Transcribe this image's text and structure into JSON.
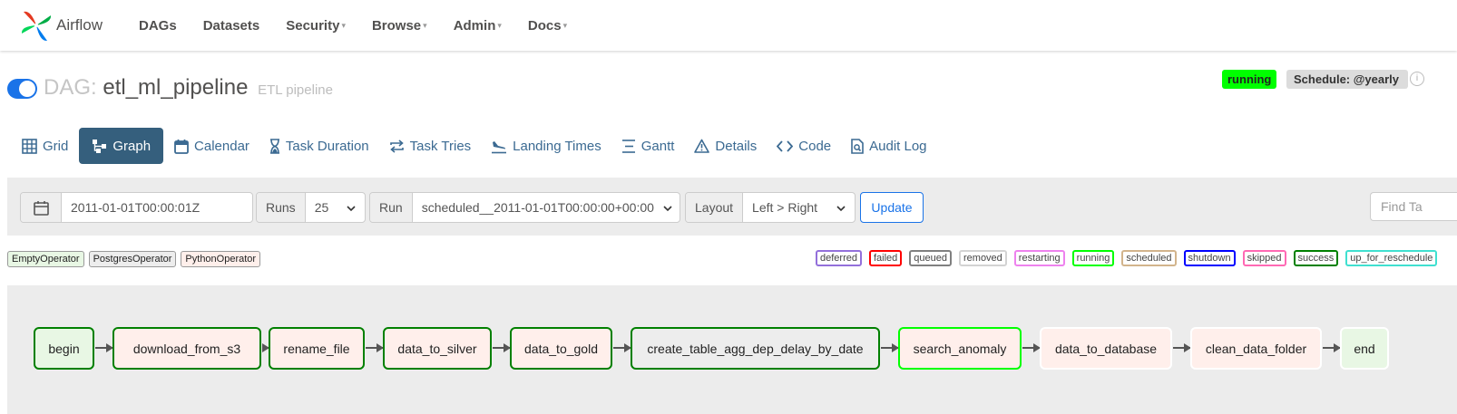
{
  "navbar": {
    "brand": "Airflow",
    "items": [
      {
        "label": "DAGs",
        "dropdown": false
      },
      {
        "label": "Datasets",
        "dropdown": false
      },
      {
        "label": "Security",
        "dropdown": true
      },
      {
        "label": "Browse",
        "dropdown": true
      },
      {
        "label": "Admin",
        "dropdown": true
      },
      {
        "label": "Docs",
        "dropdown": true
      }
    ]
  },
  "dag": {
    "prefix": "DAG:",
    "name": "etl_ml_pipeline",
    "description": "ETL pipeline",
    "status": "running",
    "schedule": "Schedule: @yearly",
    "paused": false
  },
  "tabs": [
    {
      "label": "Grid",
      "icon": "grid-icon",
      "active": false
    },
    {
      "label": "Graph",
      "icon": "graph-icon",
      "active": true
    },
    {
      "label": "Calendar",
      "icon": "calendar-icon",
      "active": false
    },
    {
      "label": "Task Duration",
      "icon": "hourglass-icon",
      "active": false
    },
    {
      "label": "Task Tries",
      "icon": "retry-icon",
      "active": false
    },
    {
      "label": "Landing Times",
      "icon": "plane-landing-icon",
      "active": false
    },
    {
      "label": "Gantt",
      "icon": "gantt-icon",
      "active": false
    },
    {
      "label": "Details",
      "icon": "warning-triangle-icon",
      "active": false
    },
    {
      "label": "Code",
      "icon": "code-icon",
      "active": false
    },
    {
      "label": "Audit Log",
      "icon": "audit-log-icon",
      "active": false
    }
  ],
  "toolbar": {
    "base_date": "2011-01-01T00:00:01Z",
    "runs_label": "Runs",
    "runs_value": "25",
    "run_label": "Run",
    "run_value": "scheduled__2011-01-01T00:00:00+00:00",
    "layout_label": "Layout",
    "layout_value": "Left > Right",
    "update_label": "Update",
    "find_placeholder": "Find Ta"
  },
  "operator_legend": [
    {
      "label": "EmptyOperator",
      "color": "#e8f7e4"
    },
    {
      "label": "PostgresOperator",
      "color": "#ededed"
    },
    {
      "label": "PythonOperator",
      "color": "#ffefeb"
    }
  ],
  "state_legend": [
    {
      "label": "deferred",
      "color": "#9370db"
    },
    {
      "label": "failed",
      "color": "#ff0000"
    },
    {
      "label": "queued",
      "color": "#808080"
    },
    {
      "label": "removed",
      "color": "#d3d3d3"
    },
    {
      "label": "restarting",
      "color": "#ee82ee"
    },
    {
      "label": "running",
      "color": "#00ff00"
    },
    {
      "label": "scheduled",
      "color": "#d2b48c"
    },
    {
      "label": "shutdown",
      "color": "#0000ff"
    },
    {
      "label": "skipped",
      "color": "#ff69b4"
    },
    {
      "label": "success",
      "color": "#008000"
    },
    {
      "label": "up_for_reschedule",
      "color": "#40e0d0"
    }
  ],
  "graph": {
    "nodes": [
      {
        "label": "begin",
        "fill": "#e8f7e4",
        "state_color": "#008000"
      },
      {
        "label": "download_from_s3",
        "fill": "#ffefeb",
        "state_color": "#008000"
      },
      {
        "label": "rename_file",
        "fill": "#ffefeb",
        "state_color": "#008000"
      },
      {
        "label": "data_to_silver",
        "fill": "#ffefeb",
        "state_color": "#008000"
      },
      {
        "label": "data_to_gold",
        "fill": "#ffefeb",
        "state_color": "#008000"
      },
      {
        "label": "create_table_agg_dep_delay_by_date",
        "fill": "#ededed",
        "state_color": "#008000"
      },
      {
        "label": "search_anomaly",
        "fill": "#ffefeb",
        "state_color": "#00ff00"
      },
      {
        "label": "data_to_database",
        "fill": "#ffefeb",
        "state_color": "#ffffff"
      },
      {
        "label": "clean_data_folder",
        "fill": "#ffefeb",
        "state_color": "#ffffff"
      },
      {
        "label": "end",
        "fill": "#e8f7e4",
        "state_color": "#ffffff"
      }
    ]
  }
}
